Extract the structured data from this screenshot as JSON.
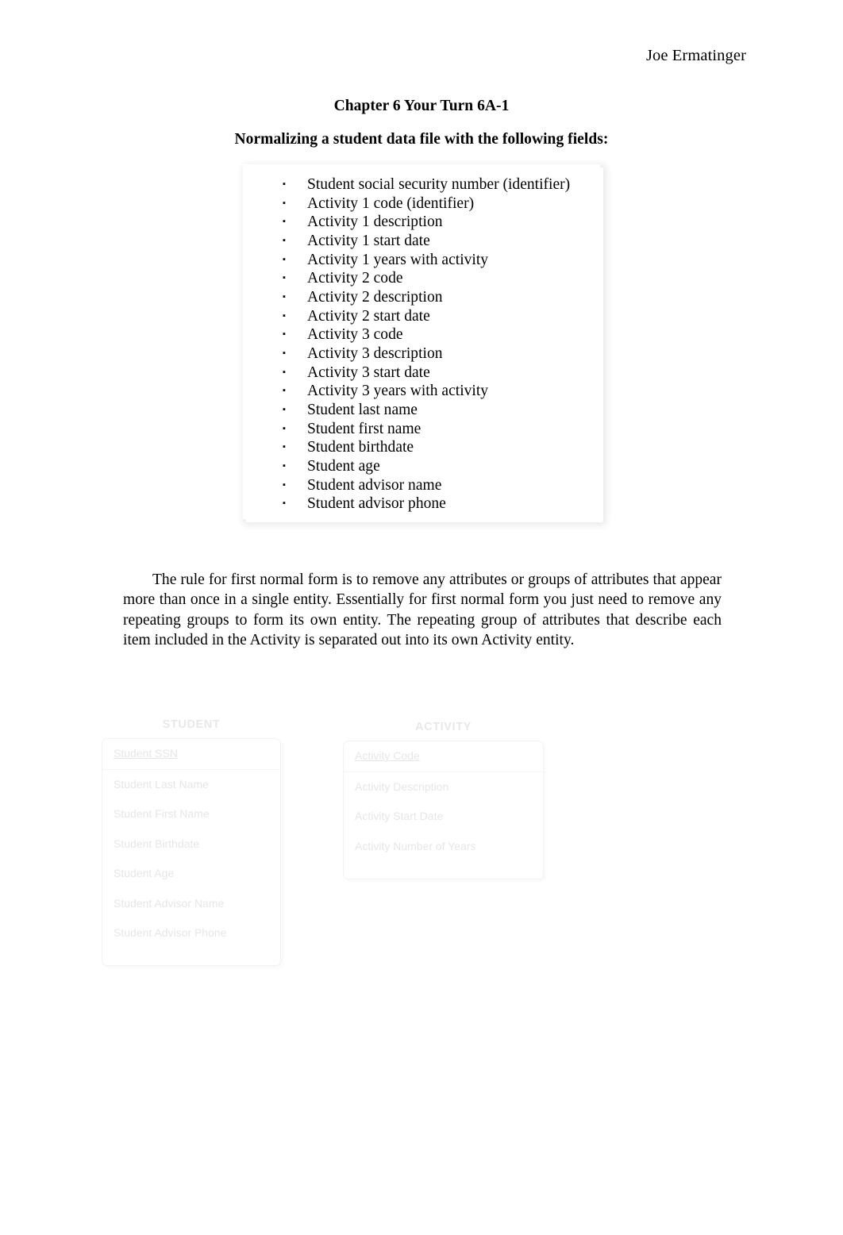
{
  "header": {
    "author": "Joe Ermatinger"
  },
  "titles": {
    "line1": "Chapter 6 Your Turn 6A-1",
    "line2": "Normalizing a student data file with the following fields:"
  },
  "field_list": {
    "bullet_glyph": "▪",
    "items": [
      "Student social security number (identifier)",
      "Activity 1 code (identifier)",
      "Activity 1 description",
      "Activity 1 start date",
      "Activity 1 years with activity",
      "Activity 2 code",
      "Activity 2 description",
      "Activity 2 start date",
      "Activity 3 code",
      "Activity 3 description",
      "Activity 3 start date",
      "Activity 3 years with activity",
      "Student last name",
      "Student first name",
      "Student birthdate",
      "Student age",
      "Student advisor name",
      "Student advisor phone"
    ]
  },
  "body": {
    "paragraph": "The rule for first normal form is to remove any attributes or groups of attributes that appear more than once in a single entity. Essentially for first normal form you just need to remove any repeating groups to form its own entity. The repeating group of attributes that describe each item included in the Activity is separated out into its own Activity entity."
  },
  "diagram": {
    "entities": [
      {
        "name": "STUDENT",
        "key_attribute": "Student SSN",
        "attributes": [
          "Student Last Name",
          "Student First Name",
          "Student Birthdate",
          "Student Age",
          "Student Advisor Name",
          "Student Advisor Phone"
        ]
      },
      {
        "name": "ACTIVITY",
        "key_attribute": "Activity Code",
        "attributes": [
          "Activity Description",
          "Activity Start Date",
          "Activity Number of Years"
        ]
      }
    ]
  }
}
